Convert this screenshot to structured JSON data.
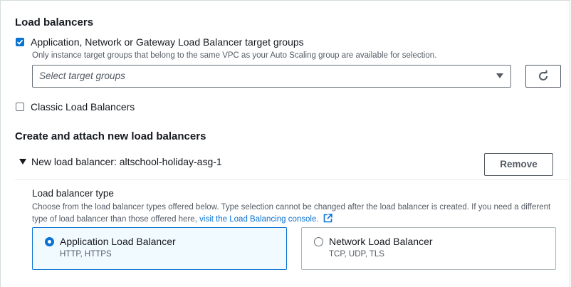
{
  "load_balancers": {
    "heading": "Load balancers",
    "target_groups_option": {
      "label": "Application, Network or Gateway Load Balancer target groups",
      "description": "Only instance target groups that belong to the same VPC as your Auto Scaling group are available for selection.",
      "checked": true
    },
    "target_groups_select": {
      "placeholder": "Select target groups"
    },
    "refresh_button": {
      "icon": "refresh-icon"
    },
    "classic_option": {
      "label": "Classic Load Balancers",
      "checked": false
    }
  },
  "create_attach": {
    "heading": "Create and attach new load balancers",
    "expander": {
      "label": "New load balancer: altschool-holiday-asg-1",
      "expanded": true
    },
    "remove_button": {
      "label": "Remove"
    },
    "type_field": {
      "label": "Load balancer type",
      "description": "Choose from the load balancer types offered below. Type selection cannot be changed after the load balancer is created. If you need a different type of load balancer than those offered here,",
      "link_text": "visit the Load Balancing console.",
      "link_icon": "external-link-icon"
    },
    "options": [
      {
        "title": "Application Load Balancer",
        "subtitle": "HTTP, HTTPS",
        "selected": true
      },
      {
        "title": "Network Load Balancer",
        "subtitle": "TCP, UDP, TLS",
        "selected": false
      }
    ]
  },
  "colors": {
    "accent": "#0972d3",
    "text": "#16191f",
    "secondary_text": "#545b64",
    "border": "#aab7b8",
    "selected_bg": "#f1faff"
  }
}
